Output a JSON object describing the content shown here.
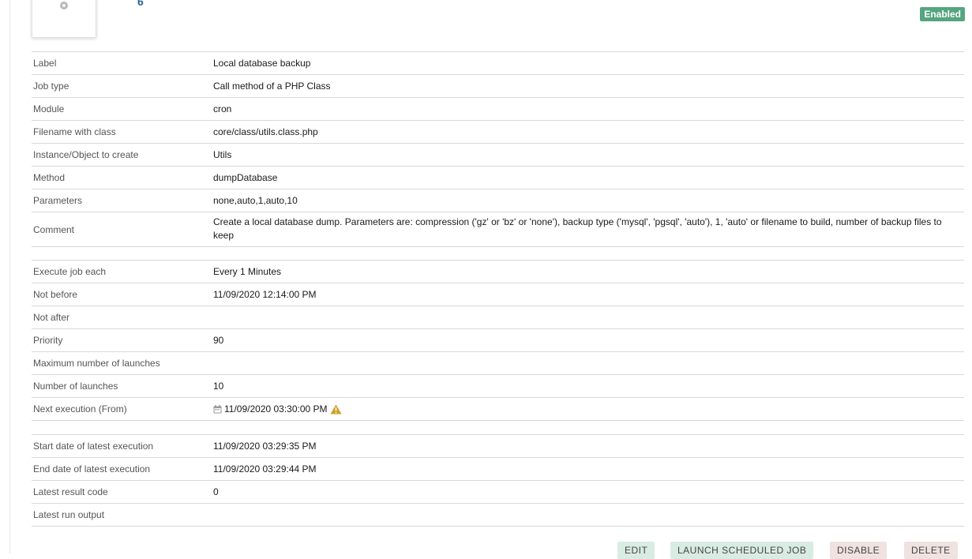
{
  "header": {
    "ref": "6",
    "status": "Enabled"
  },
  "section_general": [
    {
      "label": "Label",
      "value": "Local database backup"
    },
    {
      "label": "Job type",
      "value": "Call method of a PHP Class"
    },
    {
      "label": "Module",
      "value": "cron"
    },
    {
      "label": "Filename with class",
      "value": "core/class/utils.class.php"
    },
    {
      "label": "Instance/Object to create",
      "value": "Utils"
    },
    {
      "label": "Method",
      "value": "dumpDatabase"
    },
    {
      "label": "Parameters",
      "value": "none,auto,1,auto,10"
    },
    {
      "label": "Comment",
      "value": "Create a local database dump. Parameters are: compression ('gz' or 'bz' or 'none'), backup type ('mysql', 'pgsql', 'auto'), 1, 'auto' or filename to build, number of backup files to keep"
    }
  ],
  "section_schedule": [
    {
      "label": "Execute job each",
      "value": "Every 1 Minutes"
    },
    {
      "label": "Not before",
      "value": "11/09/2020 12:14:00 PM"
    },
    {
      "label": "Not after",
      "value": ""
    },
    {
      "label": "Priority",
      "value": "90"
    },
    {
      "label": "Maximum number of launches",
      "value": ""
    },
    {
      "label": "Number of launches",
      "value": "10"
    },
    {
      "label": "Next execution (From)",
      "value": "11/09/2020 03:30:00 PM"
    }
  ],
  "section_results": [
    {
      "label": "Start date of latest execution",
      "value": "11/09/2020 03:29:35 PM"
    },
    {
      "label": "End date of latest execution",
      "value": "11/09/2020 03:29:44 PM"
    },
    {
      "label": "Latest result code",
      "value": "0"
    },
    {
      "label": "Latest run output",
      "value": ""
    }
  ],
  "icons": {
    "photo": "gear-icon",
    "next_execution_date": "calendar-icon",
    "next_execution_warning": "warning-icon"
  },
  "actions": {
    "edit": "EDIT",
    "launch": "LAUNCH SCHEDULED JOB",
    "disable": "DISABLE",
    "delete": "DELETE"
  },
  "colors": {
    "status_badge": "#55a580",
    "ref_link": "#2a6496",
    "warning": "#c9a227"
  }
}
